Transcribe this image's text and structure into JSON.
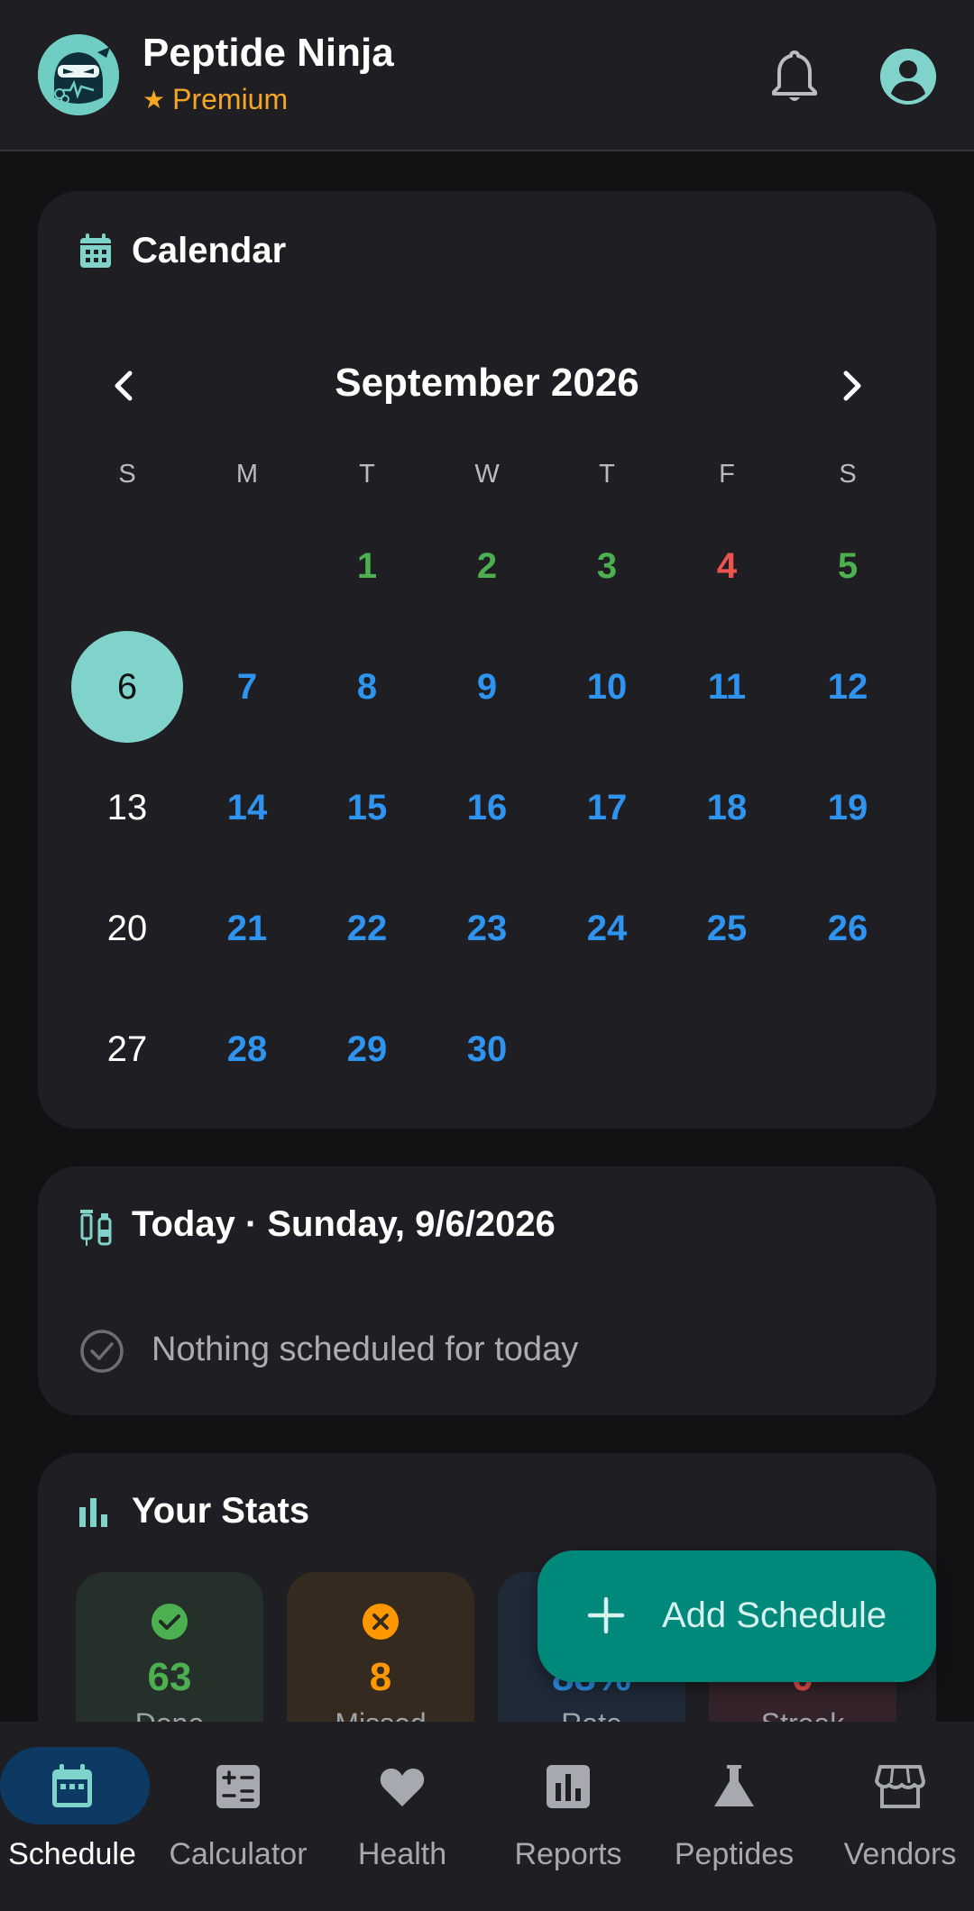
{
  "header": {
    "title": "Peptide Ninja",
    "tier": "Premium",
    "icons": {
      "notifications": "bell-icon",
      "profile": "account-circle-icon",
      "logo": "ninja-logo"
    }
  },
  "calendar": {
    "title": "Calendar",
    "month": "September 2026",
    "weekdays": [
      "S",
      "M",
      "T",
      "W",
      "T",
      "F",
      "S"
    ],
    "days": [
      {
        "d": "1",
        "status": "green"
      },
      {
        "d": "2",
        "status": "green"
      },
      {
        "d": "3",
        "status": "green"
      },
      {
        "d": "4",
        "status": "red"
      },
      {
        "d": "5",
        "status": "green"
      },
      {
        "d": "6",
        "status": "today"
      },
      {
        "d": "7",
        "status": "blue"
      },
      {
        "d": "8",
        "status": "blue"
      },
      {
        "d": "9",
        "status": "blue"
      },
      {
        "d": "10",
        "status": "blue"
      },
      {
        "d": "11",
        "status": "blue"
      },
      {
        "d": "12",
        "status": "blue"
      },
      {
        "d": "13",
        "status": "plain"
      },
      {
        "d": "14",
        "status": "blue"
      },
      {
        "d": "15",
        "status": "blue"
      },
      {
        "d": "16",
        "status": "blue"
      },
      {
        "d": "17",
        "status": "blue"
      },
      {
        "d": "18",
        "status": "blue"
      },
      {
        "d": "19",
        "status": "blue"
      },
      {
        "d": "20",
        "status": "plain"
      },
      {
        "d": "21",
        "status": "blue"
      },
      {
        "d": "22",
        "status": "blue"
      },
      {
        "d": "23",
        "status": "blue"
      },
      {
        "d": "24",
        "status": "blue"
      },
      {
        "d": "25",
        "status": "blue"
      },
      {
        "d": "26",
        "status": "blue"
      },
      {
        "d": "27",
        "status": "plain"
      },
      {
        "d": "28",
        "status": "blue"
      },
      {
        "d": "29",
        "status": "blue"
      },
      {
        "d": "30",
        "status": "blue"
      }
    ],
    "first_weekday_index": 2
  },
  "today": {
    "title": "Today · Sunday, 9/6/2026",
    "empty_message": "Nothing scheduled for today"
  },
  "stats": {
    "title": "Your Stats",
    "items": [
      {
        "value": "63",
        "label": "Done",
        "color": "#4caf50",
        "bg": "#25302a"
      },
      {
        "value": "8",
        "label": "Missed",
        "color": "#ff9800",
        "bg": "#352a1f"
      },
      {
        "value": "88%",
        "label": "Rate",
        "color": "#2f94f0",
        "bg": "#1f2a38"
      },
      {
        "value": "0",
        "label": "Streak",
        "color": "#ef5350",
        "bg": "#34232a"
      }
    ]
  },
  "fab": {
    "label": "Add Schedule"
  },
  "bottom_nav": {
    "items": [
      {
        "label": "Schedule",
        "icon": "calendar-icon",
        "active": true
      },
      {
        "label": "Calculator",
        "icon": "calculator-icon",
        "active": false
      },
      {
        "label": "Health",
        "icon": "heart-icon",
        "active": false
      },
      {
        "label": "Reports",
        "icon": "bar-chart-icon",
        "active": false
      },
      {
        "label": "Peptides",
        "icon": "flask-icon",
        "active": false
      },
      {
        "label": "Vendors",
        "icon": "store-icon",
        "active": false
      }
    ]
  },
  "colors": {
    "accent": "#7fd3ca",
    "fab": "#00897b",
    "premium": "#f5a623",
    "nav_active": "#0d3a63"
  }
}
